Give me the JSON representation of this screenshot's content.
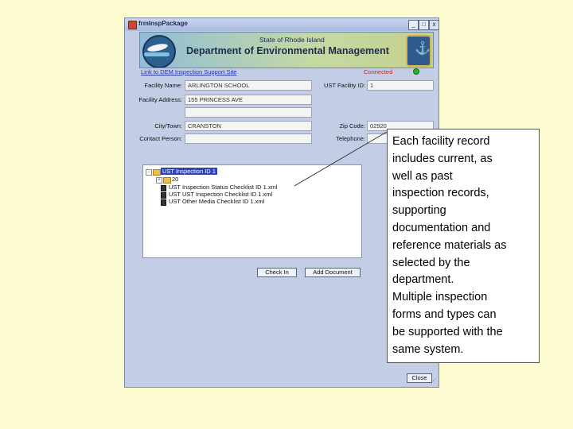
{
  "window": {
    "title": "frmInspPackage",
    "controls": {
      "minimize": "_",
      "maximize": "□",
      "close": "x"
    }
  },
  "banner": {
    "state": "State of Rhode Island",
    "department": "Department of Environmental Management"
  },
  "link": "Link to DEM Inspection Support Site",
  "status": {
    "text": "Connected",
    "color": "#2bb32b"
  },
  "form": {
    "facility_name_label": "Facility Name:",
    "facility_name_value": "ARLINGTON SCHOOL",
    "ust_facility_id_label": "UST Facility ID:",
    "ust_facility_id_value": "1",
    "facility_address_label": "Facility Address:",
    "facility_address_value": "155 PRINCESS AVE",
    "facility_address_2_value": "",
    "city_label": "City/Town:",
    "city_value": "CRANSTON",
    "zip_label": "Zip Code:",
    "zip_value": "02920",
    "contact_label": "Contact Person:",
    "contact_value": "",
    "telephone_label": "Telephone:",
    "telephone_value": ""
  },
  "tree": {
    "root": "UST Inspection ID 1",
    "child_folder": "20",
    "files": [
      "UST Inspection Status Checklist ID 1.xml",
      "UST UST Inspection Checklist ID 1.xml",
      "UST Other Media Checklist ID 1.xml"
    ]
  },
  "buttons": {
    "check_in": "Check In",
    "add_document": "Add Document",
    "close": "Close"
  },
  "callout": {
    "lines": [
      "Each facility record",
      "includes current, as",
      "well as past",
      "inspection records,",
      "supporting",
      "documentation and",
      "reference materials as",
      "selected by the",
      "department.",
      "Multiple inspection",
      "forms and types can",
      "be supported with the",
      "same system."
    ]
  }
}
